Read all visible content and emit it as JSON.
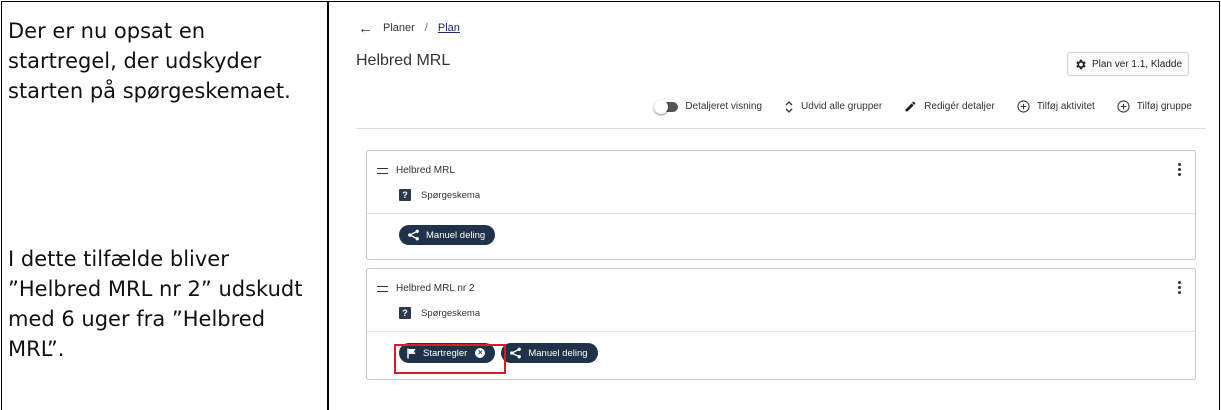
{
  "instructions": {
    "note_1": "Der er nu opsat en startregel, der udskyder starten på spørgeskemaet.",
    "note_2": "I dette tilfælde bliver ”Helbred MRL nr 2” udskudt med 6 uger fra ”Helbred MRL”."
  },
  "breadcrumb": {
    "back_icon": "arrow-left-icon",
    "parent": "Planer",
    "separator": "/",
    "current": "Plan"
  },
  "page": {
    "title": "Helbred MRL",
    "version_label": "Plan ver 1.1, Kladde"
  },
  "toolbar": {
    "detailed_view": "Detaljeret visning",
    "expand_groups": "Udvid alle grupper",
    "edit_details": "Redigér detaljer",
    "add_activity": "Tilføj aktivitet",
    "add_group": "Tilføj gruppe"
  },
  "groups": [
    {
      "name": "Helbred MRL",
      "activity": "Spørgeskema",
      "chips": [
        "Manuel deling"
      ]
    },
    {
      "name": "Helbred MRL nr 2",
      "activity": "Spørgeskema",
      "chips": [
        "Startregler",
        "Manuel deling"
      ]
    }
  ],
  "colors": {
    "chip_bg": "#1f3249",
    "highlight": "#e0182d"
  }
}
